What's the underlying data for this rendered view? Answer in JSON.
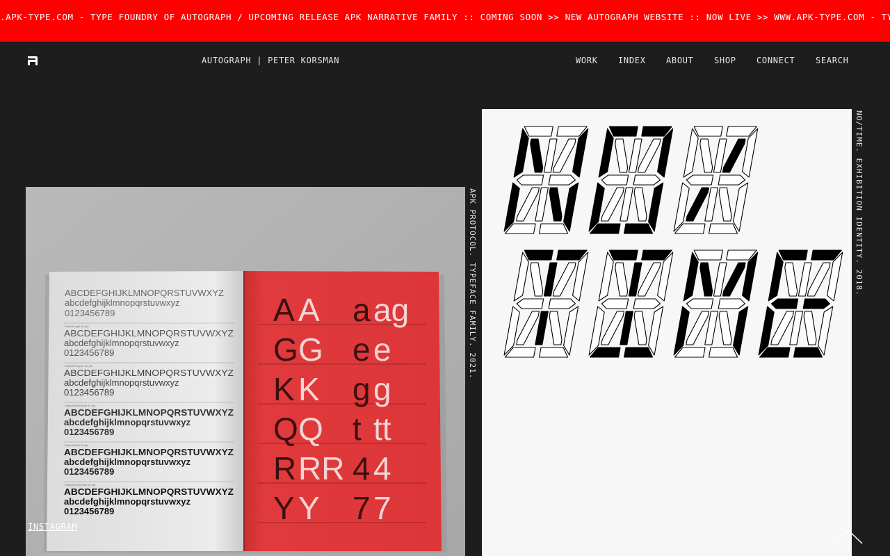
{
  "ticker": {
    "text": ".APK-TYPE.COM - TYPE FOUNDRY OF AUTOGRAPH / UPCOMING RELEASE APK NARRATIVE FAMILY :: COMING SOON >> NEW AUTOGRAPH WEBSITE :: NOW LIVE >> WWW.APK-TYPE.COM - TYPE FOUNDRY OF AUTOGRAPH",
    "color": "#ff0000"
  },
  "header": {
    "logo_icon": "autograph-logo-icon",
    "site_title": "AUTOGRAPH | PETER KORSMAN",
    "nav": [
      "WORK",
      "INDEX",
      "ABOUT",
      "SHOP",
      "CONNECT",
      "SEARCH"
    ]
  },
  "projects": [
    {
      "caption": "APK PROTOCOL. TYPEFACE FAMILY. 2021.",
      "specimen": {
        "upper": "ABCDEFGHIJKLMNOPQRSTUVWXYZ",
        "lower": "abcdefghijklmnopqrstuvwxyz",
        "digits": "0123456789",
        "weights": [
          "Default Light 20 pts.",
          "Default Regular 20 pts.",
          "Default Semi Bold 20 pts.",
          "Default Bold 20 pts.",
          "Default Extra Bold 20 pts."
        ],
        "pairs": [
          [
            "A",
            "A",
            "a",
            "ag"
          ],
          [
            "G",
            "G",
            "e",
            "e"
          ],
          [
            "K",
            "K",
            "g",
            "g"
          ],
          [
            "Q",
            "Q",
            "t",
            "tt"
          ],
          [
            "R",
            "RR",
            "4",
            "4"
          ],
          [
            "Y",
            "Y",
            "7",
            "7"
          ]
        ],
        "page_color": "#e23a3c"
      }
    },
    {
      "caption": "NO/TIME. EXHIBITION IDENTITY. 2018.",
      "artwork_rows": [
        [
          "N",
          "O",
          "/"
        ],
        [
          "T",
          "I",
          "M",
          "E"
        ]
      ]
    }
  ],
  "footer": {
    "instagram": "INSTAGRAM",
    "top_icon": "chevron-up-icon"
  }
}
